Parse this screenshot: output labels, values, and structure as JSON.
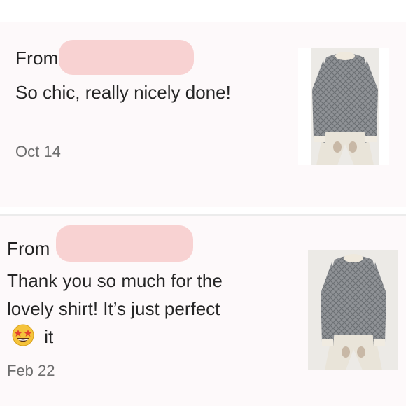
{
  "reviews": [
    {
      "from_label": "From",
      "text": "So chic, really nicely done!",
      "date": "Oct 14",
      "thumbnail": "gray-knit-sweater-photo"
    },
    {
      "from_label": "From",
      "text_before": "Thank you so much for the lovely shirt! It’s just perfect",
      "emoji": "star-struck-emoji",
      "text_after": "it",
      "date": "Feb 22",
      "thumbnail": "gray-knit-sweater-photo"
    }
  ],
  "colors": {
    "card_background": "#fdf9fa",
    "redaction": "#f8d2d2",
    "divider": "#ececec",
    "date_text": "#6e6e6e"
  }
}
